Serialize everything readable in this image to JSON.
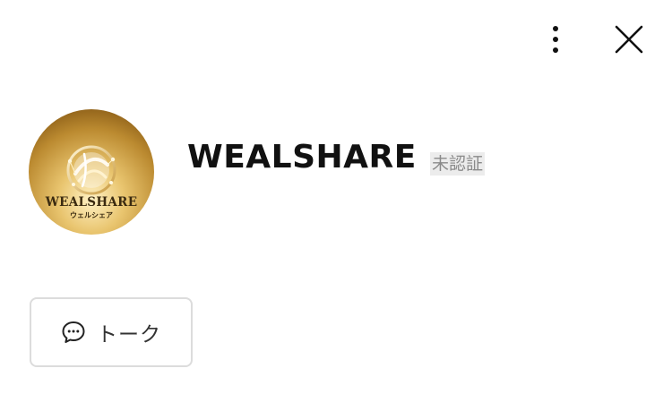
{
  "header": {
    "more_icon": "more-vertical-icon",
    "close_icon": "close-icon"
  },
  "profile": {
    "name": "WEALSHARE",
    "status_badge": "未認証",
    "avatar": {
      "logo_text": "WEALSHARE",
      "logo_subtext": "ウェルシェア",
      "gold_light": "#f3d68a",
      "gold_dark": "#a4741f"
    }
  },
  "actions": {
    "talk": {
      "label": "トーク",
      "icon": "chat-bubble-icon"
    }
  }
}
